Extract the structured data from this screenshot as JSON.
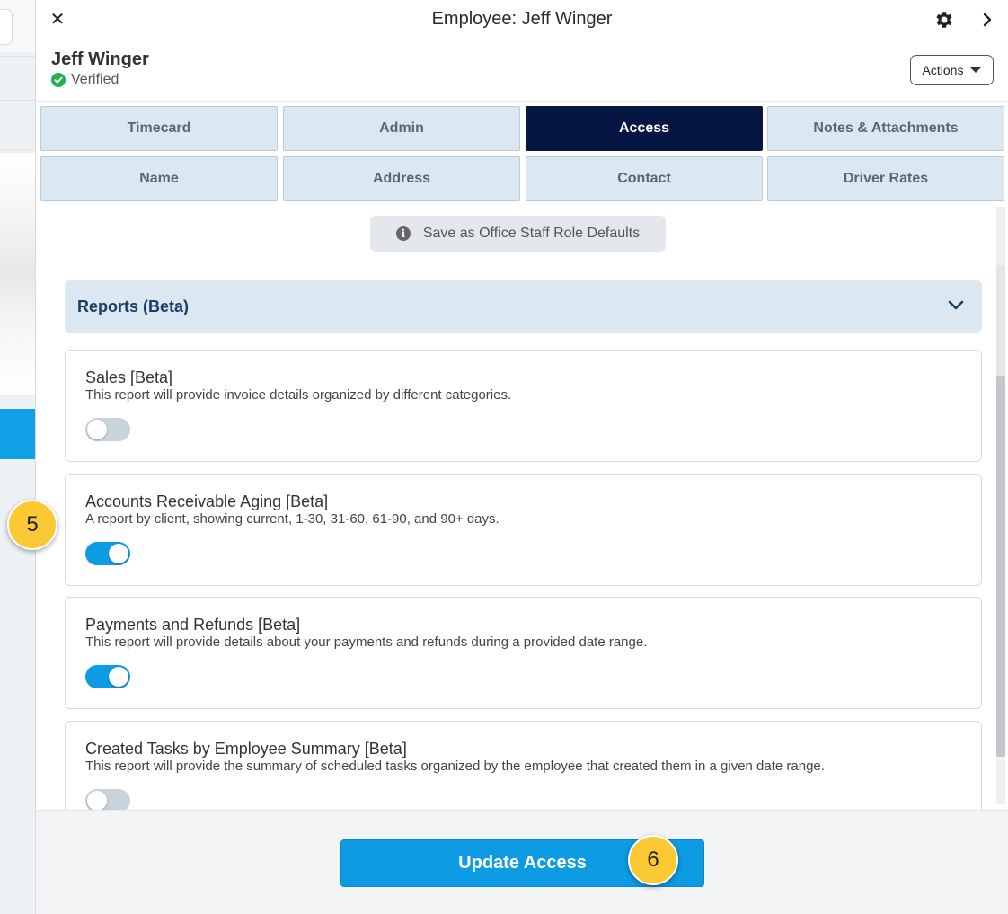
{
  "header": {
    "title": "Employee: Jeff Winger",
    "close_glyph": "✕",
    "icons": [
      "close-icon",
      "gear-icon",
      "chevron-right-icon"
    ]
  },
  "employee": {
    "name": "Jeff Winger",
    "status": "Verified",
    "actions_label": "Actions"
  },
  "tabs": [
    {
      "label": "Timecard",
      "active": false
    },
    {
      "label": "Admin",
      "active": false
    },
    {
      "label": "Access",
      "active": true
    },
    {
      "label": "Notes & Attachments",
      "active": false
    },
    {
      "label": "Name",
      "active": false
    },
    {
      "label": "Address",
      "active": false
    },
    {
      "label": "Contact",
      "active": false
    },
    {
      "label": "Driver Rates",
      "active": false
    }
  ],
  "save_defaults_label": "Save as Office Staff Role Defaults",
  "section": {
    "title": "Reports (Beta)"
  },
  "reports": [
    {
      "title": "Sales [Beta]",
      "description": "This report will provide invoice details organized by different categories.",
      "enabled": false
    },
    {
      "title": "Accounts Receivable Aging [Beta]",
      "description": "A report by client, showing current, 1-30, 31-60, 61-90, and 90+ days.",
      "enabled": true
    },
    {
      "title": "Payments and Refunds [Beta]",
      "description": "This report will provide details about your payments and refunds during a provided date range.",
      "enabled": true
    },
    {
      "title": "Created Tasks by Employee Summary [Beta]",
      "description": "This report will provide the summary of scheduled tasks organized by the employee that created them in a given date range.",
      "enabled": false
    }
  ],
  "footer": {
    "update_label": "Update Access"
  },
  "step_badges": [
    "5",
    "6"
  ],
  "colors": {
    "accent": "#0d9be3",
    "active_tab": "#061642",
    "verified": "#22b14c",
    "badge": "#fbc934"
  }
}
